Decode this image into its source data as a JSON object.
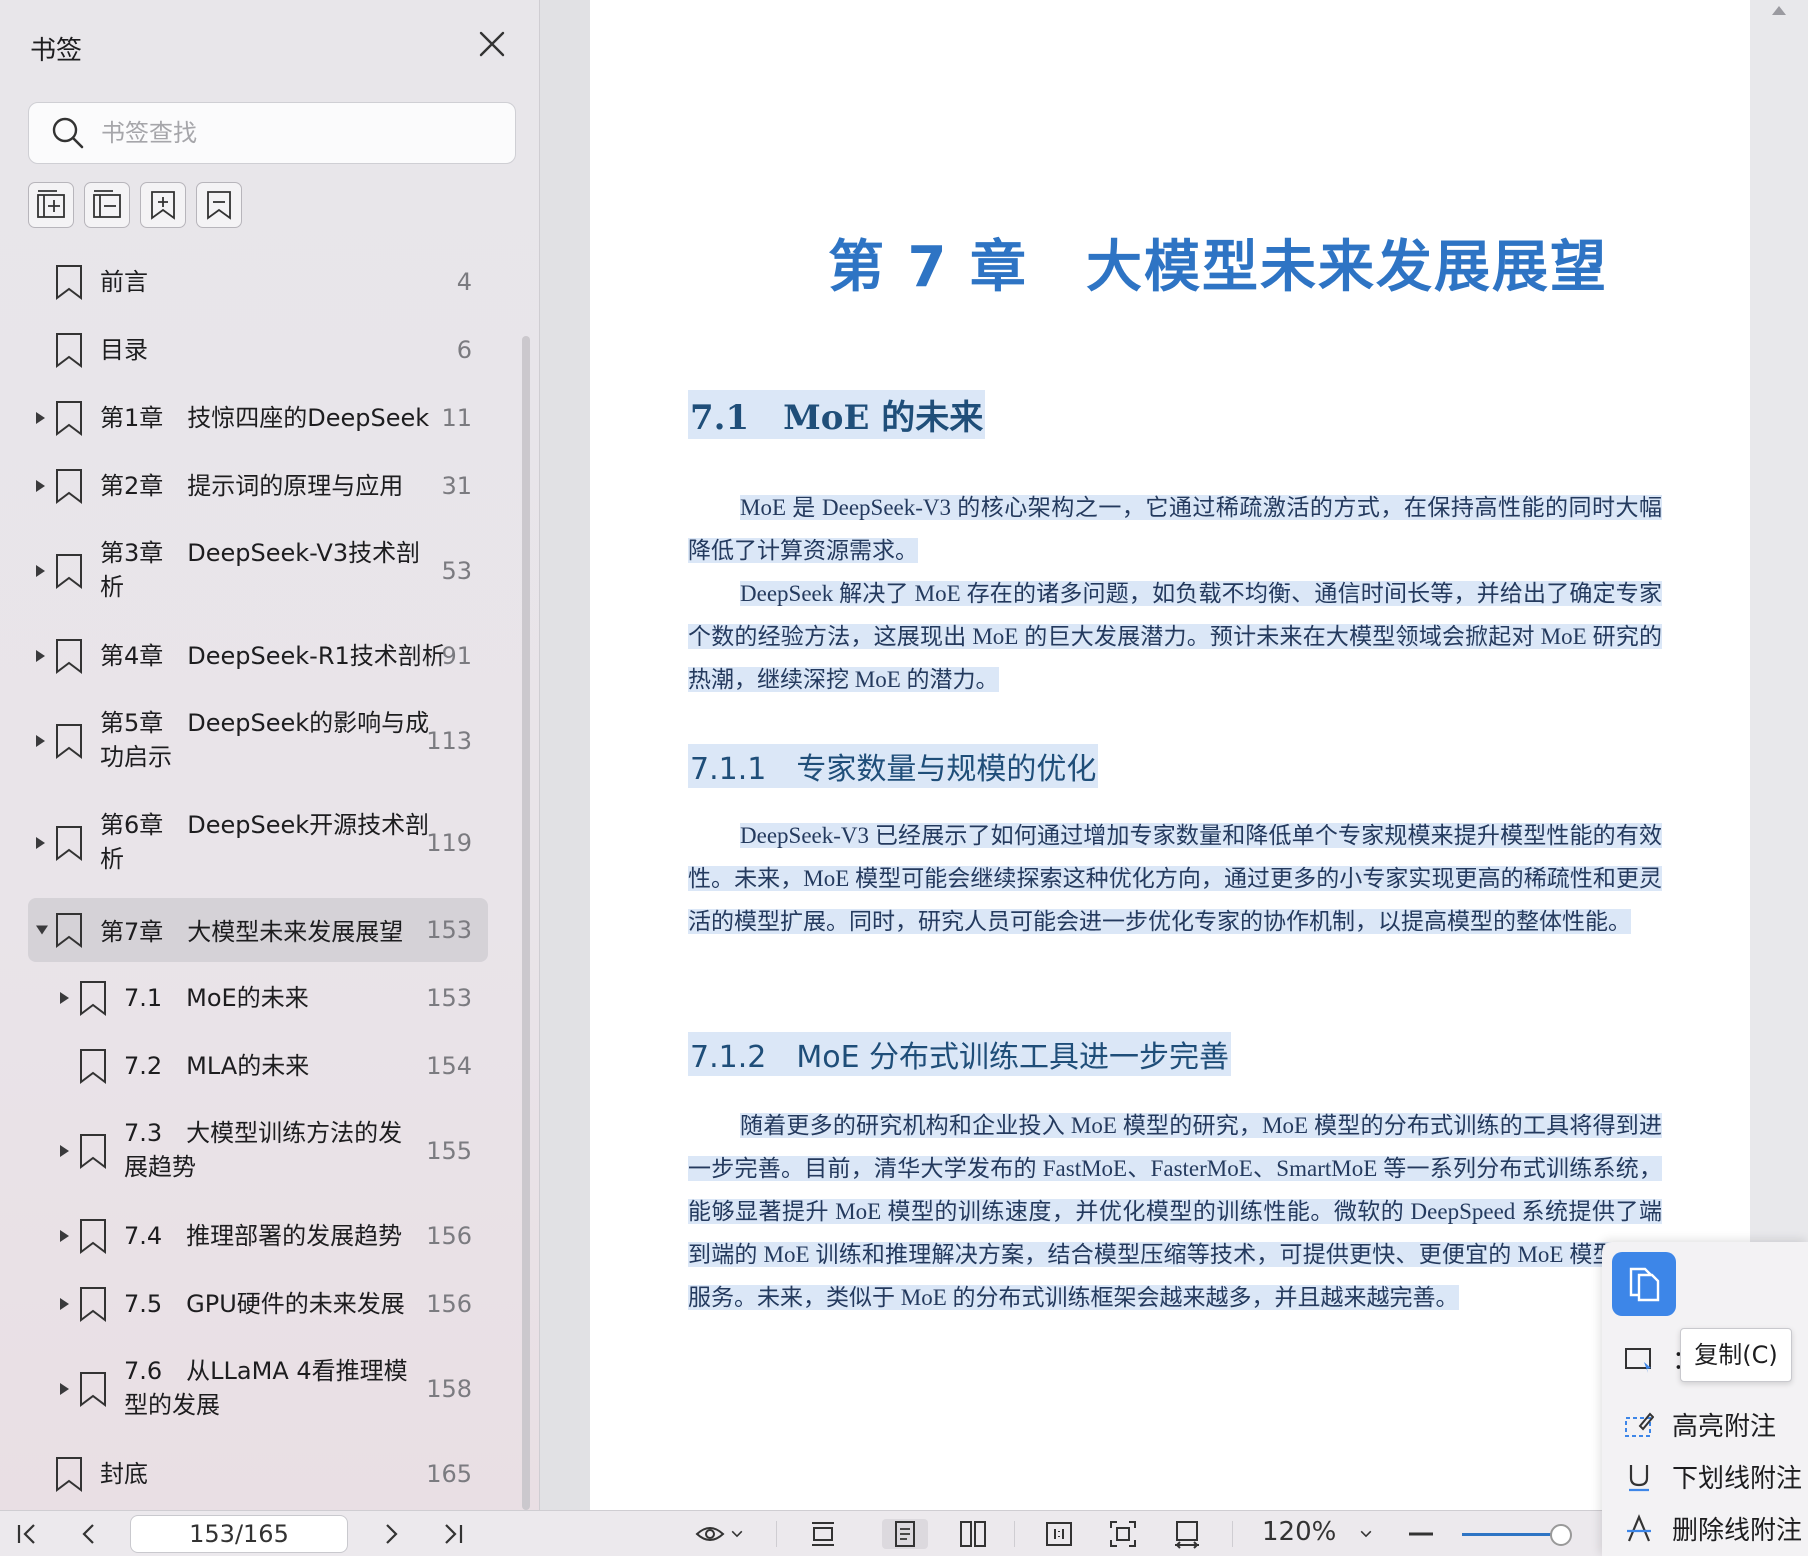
{
  "sidebar": {
    "title": "书签",
    "search_placeholder": "书签查找",
    "bookmarks": [
      {
        "label": "前言",
        "page": "4"
      },
      {
        "label": "目录",
        "page": "6"
      },
      {
        "label": "第1章　技惊四座的DeepSeek",
        "page": "11"
      },
      {
        "label": "第2章　提示词的原理与应用",
        "page": "31"
      },
      {
        "label": "第3章　DeepSeek-V3技术剖\n析",
        "page": "53"
      },
      {
        "label": "第4章　DeepSeek-R1技术剖析",
        "page": "91"
      },
      {
        "label": "第5章　DeepSeek的影响与成\n功启示",
        "page": "113"
      },
      {
        "label": "第6章　DeepSeek开源技术剖\n析",
        "page": "119"
      },
      {
        "label": "第7章　大模型未来发展展望",
        "page": "153"
      },
      {
        "label": "7.1　MoE的未来",
        "page": "153"
      },
      {
        "label": "7.2　MLA的未来",
        "page": "154"
      },
      {
        "label": "7.3　大模型训练方法的发\n展趋势",
        "page": "155"
      },
      {
        "label": "7.4　推理部署的发展趋势",
        "page": "156"
      },
      {
        "label": "7.5　GPU硬件的未来发展",
        "page": "156"
      },
      {
        "label": "7.6　从LLaMA 4看推理模\n型的发展",
        "page": "158"
      },
      {
        "label": "封底",
        "page": "165"
      }
    ]
  },
  "document": {
    "chapter_title": "第 7 章　大模型未来发展展望",
    "section_title": "7.1　MoE 的未来",
    "para1": "MoE 是 DeepSeek-V3 的核心架构之一，它通过稀疏激活的方式，在保持高性能的同时大幅降低了计算资源需求。",
    "para2": "DeepSeek 解决了 MoE 存在的诸多问题，如负载不均衡、通信时间长等，并给出了确定专家个数的经验方法，这展现出 MoE 的巨大发展潜力。预计未来在大模型领域会掀起对 MoE 研究的热潮，继续深挖 MoE 的潜力。",
    "subsection1_title": "7.1.1　专家数量与规模的优化",
    "para3": "DeepSeek-V3 已经展示了如何通过增加专家数量和降低单个专家规模来提升模型性能的有效性。未来，MoE 模型可能会继续探索这种优化方向，通过更多的小专家实现更高的稀疏性和更灵活的模型扩展。同时，研究人员可能会进一步优化专家的协作机制，以提高模型的整体性能。",
    "subsection2_title": "7.1.2　MoE 分布式训练工具进一步完善",
    "para4": "随着更多的研究机构和企业投入 MoE 模型的研究，MoE 模型的分布式训练的工具将得到进一步完善。目前，清华大学发布的 FastMoE、FasterMoE、SmartMoE 等一系列分布式训练系统，能够显著提升 MoE 模型的训练速度，并优化模型的训练性能。微软的 DeepSpeed 系统提供了端到端的 MoE 训练和推理解决方案，结合模型压缩等技术，可提供更快、更便宜的 MoE 模型推理服务。未来，类似于 MoE 的分布式训练框架会越来越多，并且越来越完善。"
  },
  "toolbar": {
    "page_indicator": "153/165",
    "zoom": "120%"
  },
  "context_menu": {
    "copy_tooltip": "复制(C)",
    "partial_label": "：",
    "highlight": "高亮附注",
    "underline": "下划线附注",
    "strikethrough": "删除线附注"
  }
}
